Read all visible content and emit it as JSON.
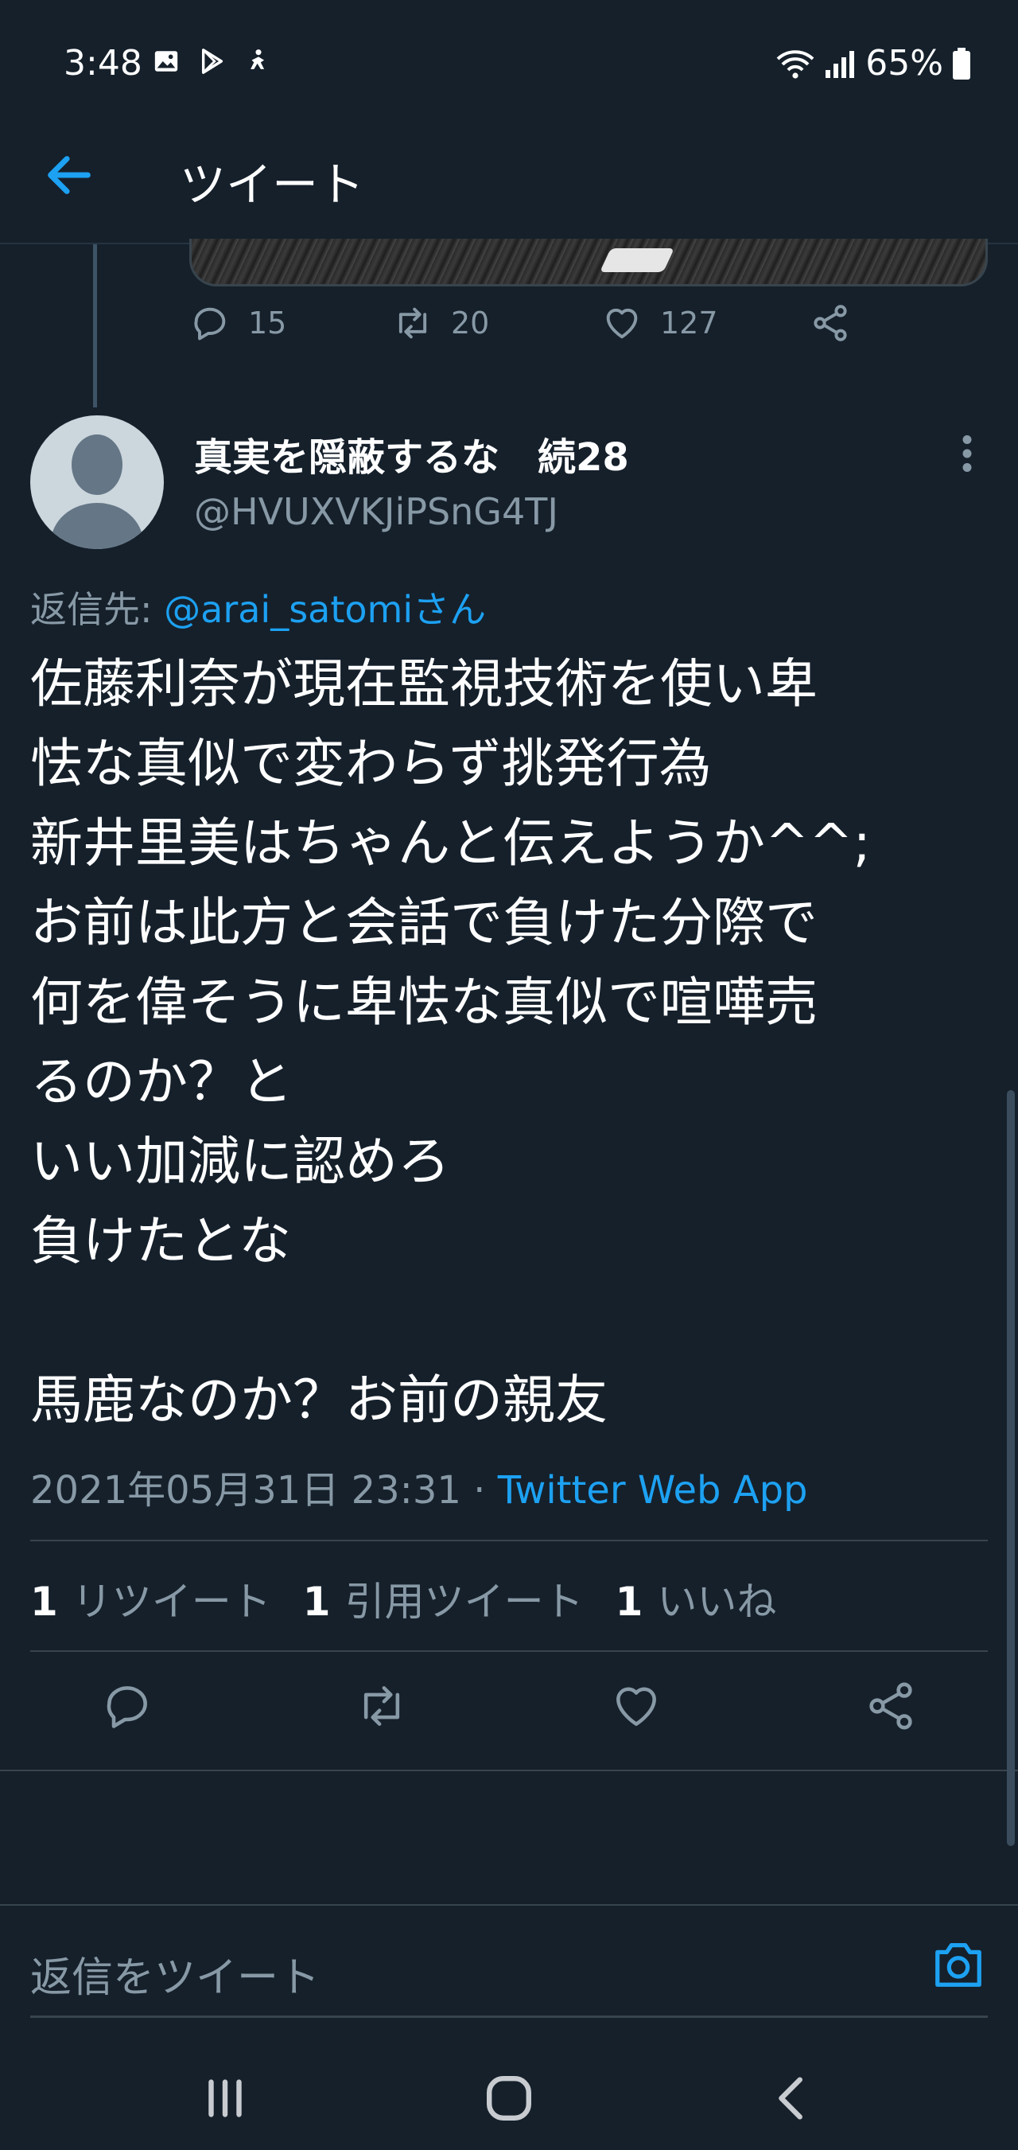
{
  "status_bar": {
    "time": "3:48",
    "battery": "65%",
    "icons": [
      "image-icon",
      "play-store-icon",
      "accessibility-icon",
      "wifi-icon",
      "signal-icon",
      "battery-icon"
    ]
  },
  "header": {
    "title": "ツイート",
    "back_icon": "arrow-left-icon"
  },
  "previous_tweet": {
    "reply_count": "15",
    "retweet_count": "20",
    "like_count": "127"
  },
  "tweet": {
    "author_name": "真実を隠蔽するな　続28",
    "author_handle": "@HVUXVKJiPSnG4TJ",
    "reply_to_label": "返信先: ",
    "reply_to_mention": "@arai_satomiさん",
    "text_lines": [
      "佐藤利奈が現在監視技術を使い卑",
      "怯な真似で変わらず挑発行為",
      "新井里美はちゃんと伝えようか^^;",
      "お前は此方と会話で負けた分際で",
      "何を偉そうに卑怯な真似で喧嘩売",
      "るのか？と",
      "いい加減に認めろ",
      "負けたとな",
      "",
      "馬鹿なのか？お前の親友"
    ],
    "timestamp": "2021年05月31日 23:31 · ",
    "source": "Twitter Web App",
    "stats": {
      "retweets_count": "1",
      "retweets_label": "リツイート",
      "quotes_count": "1",
      "quotes_label": "引用ツイート",
      "likes_count": "1",
      "likes_label": "いいね"
    }
  },
  "reply_composer": {
    "placeholder": "返信をツイート"
  },
  "colors": {
    "background": "#15202b",
    "accent": "#1da1f2",
    "secondary_text": "#8899a6",
    "divider": "#38444d"
  }
}
